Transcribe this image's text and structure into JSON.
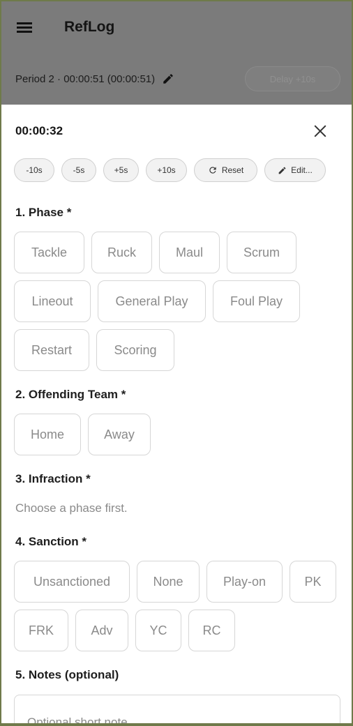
{
  "app": {
    "title": "RefLog"
  },
  "period": {
    "text": "Period 2 · 00:00:51 (00:00:51)",
    "delay_label": "Delay +10s"
  },
  "sheet": {
    "timer": "00:00:32",
    "adjust_buttons": [
      "-10s",
      "-5s",
      "+5s",
      "+10s"
    ],
    "reset_label": "Reset",
    "edit_label": "Edit..."
  },
  "sections": {
    "phase": {
      "title": "1. Phase *",
      "options": [
        "Tackle",
        "Ruck",
        "Maul",
        "Scrum",
        "Lineout",
        "General Play",
        "Foul Play",
        "Restart",
        "Scoring"
      ]
    },
    "team": {
      "title": "2. Offending Team *",
      "options": [
        "Home",
        "Away"
      ]
    },
    "infraction": {
      "title": "3. Infraction *",
      "hint": "Choose a phase first."
    },
    "sanction": {
      "title": "4. Sanction *",
      "options": [
        "Unsanctioned",
        "None",
        "Play-on",
        "PK",
        "FRK",
        "Adv",
        "YC",
        "RC"
      ]
    },
    "notes": {
      "title": "5. Notes (optional)",
      "placeholder": "Optional short note"
    }
  }
}
